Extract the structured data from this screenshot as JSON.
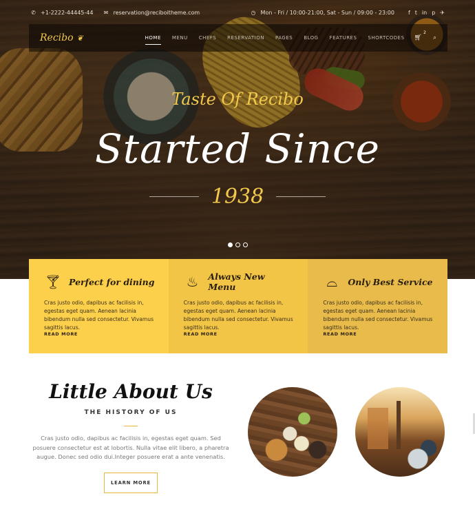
{
  "topbar": {
    "phone": "+1-2222-44445-44",
    "email": "reservation@reciboitheme.com",
    "hours": "Mon - Fri / 10:00-21:00, Sat - Sun / 09:00 - 23:00",
    "social_icons": [
      "facebook-icon",
      "twitter-icon",
      "linkedin-icon",
      "pinterest-icon",
      "twitter-bird-icon"
    ]
  },
  "nav": {
    "logo": "Recibo",
    "items": [
      "HOME",
      "MENU",
      "CHEFS",
      "RESERVATION",
      "PAGES",
      "BLOG",
      "FEATURES",
      "SHORTCODES"
    ],
    "active": "HOME",
    "cart_count": "2"
  },
  "hero": {
    "tagline": "Taste Of Recibo",
    "headline": "Started Since",
    "year": "1938",
    "slides": 3,
    "active_slide": 1
  },
  "features": [
    {
      "icon": "cocktail-icon",
      "title": "Perfect for dining",
      "text": "Cras justo odio, dapibus ac facilisis in, egestas eget quam. Aenean lacinia bibendum nulla sed consectetur. Vivamus sagittis lacus.",
      "link": "READ MORE"
    },
    {
      "icon": "soup-bowl-icon",
      "title": "Always New Menu",
      "text": "Cras justo odio, dapibus ac facilisis in, egestas eget quam. Aenean lacinia bibendum nulla sed consectetur. Vivamus sagittis lacus.",
      "link": "READ MORE"
    },
    {
      "icon": "cloche-icon",
      "title": "Only Best Service",
      "text": "Cras justo odio, dapibus ac facilisis in, egestas eget quam. Aenean lacinia bibendum nulla sed consectetur. Vivamus sagittis lacus.",
      "link": "READ MORE"
    }
  ],
  "about": {
    "title": "Little About Us",
    "subtitle": "THE HISTORY OF US",
    "text": "Cras justo odio, dapibus ac facilisis in, egestas eget quam. Sed posuere consectetur est at lobortis. Nulla vitae elit libero, a pharetra augue. Donec sed odio dui.Integer posuere erat a ante venenatis.",
    "button": "LEARN MORE"
  },
  "colors": {
    "accent": "#f2c94c",
    "feature_1": "#fcd04b",
    "feature_2": "#f3c546",
    "feature_3": "#e8bb4a"
  }
}
